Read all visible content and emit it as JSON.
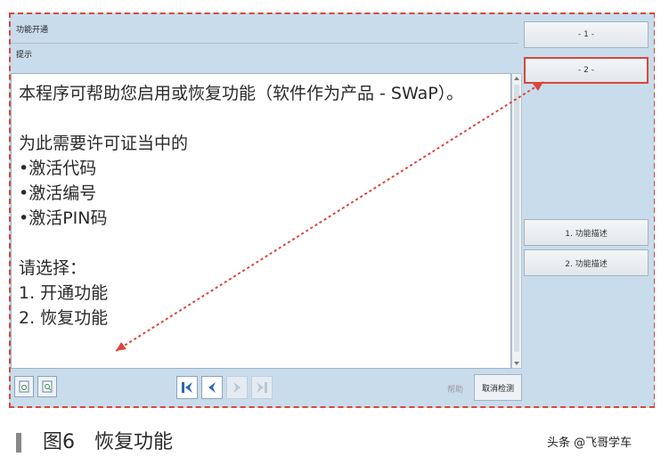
{
  "window": {
    "title": "功能开通",
    "hint": "提示"
  },
  "content": {
    "lines": [
      "本程序可帮助您启用或恢复功能（软件作为产品 - SWaP）。",
      "",
      "为此需要许可证当中的",
      "•激活代码",
      "•激活编号",
      "•激活PIN码",
      "",
      "请选择：",
      "1. 开通功能",
      "2. 恢复功能"
    ]
  },
  "sidebar": {
    "buttons": [
      {
        "label": "- 1 -"
      },
      {
        "label": "- 2 -"
      },
      {
        "label": "1. 功能描述"
      },
      {
        "label": "2. 功能描述"
      }
    ]
  },
  "toolbar": {
    "help_label": "帮助",
    "cancel_label": "取消检测"
  },
  "caption": {
    "figure": "图6",
    "title": "恢复功能",
    "credit": "头条 @飞哥学车"
  },
  "colors": {
    "panel": "#c9dcec",
    "annotation": "#d9473a",
    "nav_blue": "#2a66b8"
  }
}
